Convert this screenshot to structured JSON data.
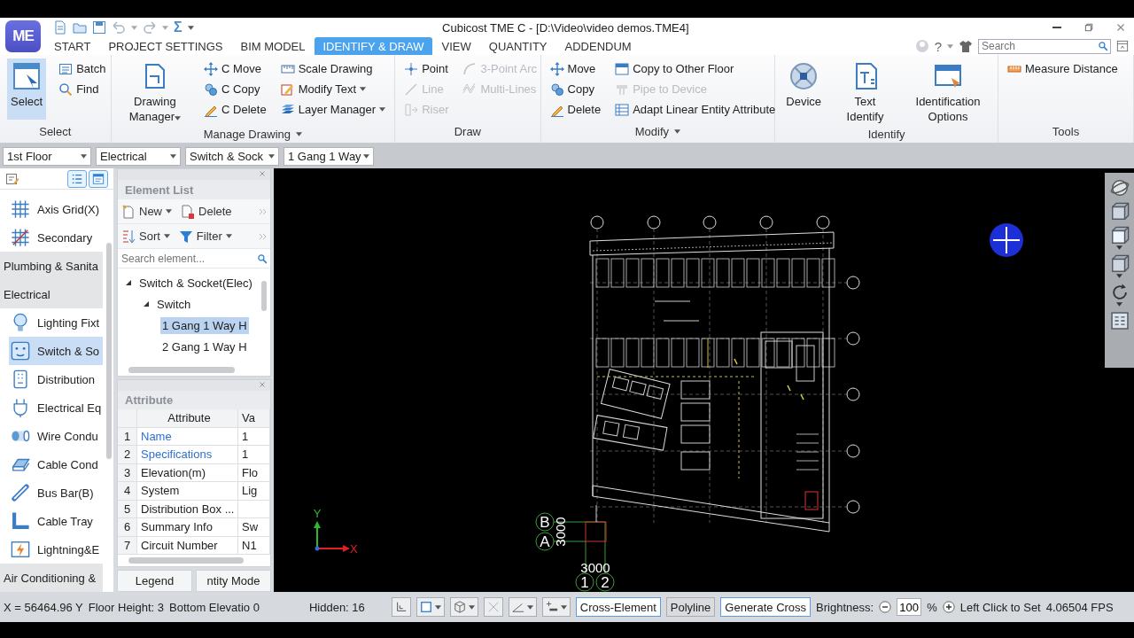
{
  "window": {
    "logo": "ME",
    "formula_symbol": "Σ",
    "title": "Cubicost TME C - [D:\\Video\\video demos.TME4]"
  },
  "menu_tabs": [
    {
      "label": "START",
      "selected": false
    },
    {
      "label": "PROJECT SETTINGS",
      "selected": false
    },
    {
      "label": "BIM MODEL",
      "selected": false
    },
    {
      "label": "IDENTIFY & DRAW",
      "selected": true
    },
    {
      "label": "VIEW",
      "selected": false
    },
    {
      "label": "QUANTITY",
      "selected": false
    },
    {
      "label": "ADDENDUM",
      "selected": false
    }
  ],
  "help": "?",
  "search": {
    "placeholder": "Search"
  },
  "ribbon": [
    {
      "label": "Select",
      "dropdown": false,
      "columns": [
        {
          "kind": "large",
          "label": "Select",
          "selected": true,
          "dropdown": false
        },
        {
          "kind": "stack",
          "items": [
            {
              "label": "Batch",
              "disabled": false,
              "dropdown": false
            },
            {
              "label": "Find",
              "disabled": false,
              "dropdown": false
            }
          ]
        }
      ]
    },
    {
      "label": "Manage Drawing",
      "dropdown": true,
      "columns": [
        {
          "kind": "large",
          "label": "Drawing Manager",
          "selected": false,
          "dropdown": true
        },
        {
          "kind": "stack",
          "items": [
            {
              "label": "C Move",
              "disabled": false,
              "dropdown": false
            },
            {
              "label": "C Copy",
              "disabled": false,
              "dropdown": false
            },
            {
              "label": "C Delete",
              "disabled": false,
              "dropdown": false
            }
          ]
        },
        {
          "kind": "stack",
          "items": [
            {
              "label": "Scale Drawing",
              "disabled": false,
              "dropdown": false
            },
            {
              "label": "Modify Text",
              "disabled": false,
              "dropdown": true
            },
            {
              "label": "Layer Manager",
              "disabled": false,
              "dropdown": true
            }
          ]
        }
      ]
    },
    {
      "label": "Draw",
      "dropdown": false,
      "columns": [
        {
          "kind": "stack",
          "items": [
            {
              "label": "Point",
              "disabled": false,
              "dropdown": false
            },
            {
              "label": "Line",
              "disabled": true,
              "dropdown": false
            },
            {
              "label": "Riser",
              "disabled": true,
              "dropdown": false
            }
          ]
        },
        {
          "kind": "stack",
          "items": [
            {
              "label": "3-Point Arc",
              "disabled": true,
              "dropdown": false
            },
            {
              "label": "Multi-Lines",
              "disabled": true,
              "dropdown": false
            }
          ]
        }
      ]
    },
    {
      "label": "Modify",
      "dropdown": true,
      "columns": [
        {
          "kind": "stack",
          "items": [
            {
              "label": "Move",
              "disabled": false,
              "dropdown": false
            },
            {
              "label": "Copy",
              "disabled": false,
              "dropdown": false
            },
            {
              "label": "Delete",
              "disabled": false,
              "dropdown": false
            }
          ]
        },
        {
          "kind": "stack",
          "items": [
            {
              "label": "Copy to Other Floor",
              "disabled": false,
              "dropdown": false
            },
            {
              "label": "Pipe to Device",
              "disabled": true,
              "dropdown": false
            },
            {
              "label": "Adapt Linear Entity Attribute",
              "disabled": false,
              "dropdown": false
            }
          ]
        }
      ]
    },
    {
      "label": "Identify",
      "dropdown": false,
      "columns": [
        {
          "kind": "large",
          "label": "Device",
          "selected": false,
          "dropdown": false
        },
        {
          "kind": "large",
          "label": "Text Identify",
          "selected": false,
          "dropdown": false
        },
        {
          "kind": "large",
          "label": "Identification Options",
          "selected": false,
          "dropdown": false
        }
      ]
    },
    {
      "label": "Tools",
      "dropdown": false,
      "columns": [
        {
          "kind": "stack",
          "items": [
            {
              "label": "Measure Distance",
              "disabled": false,
              "dropdown": false
            }
          ]
        }
      ]
    }
  ],
  "selectors": [
    "1st Floor",
    "Electrical",
    "Switch & Sock",
    "1 Gang 1 Way"
  ],
  "component_panel": [
    {
      "kind": "item",
      "label": "Axis Grid(X)",
      "selected": false
    },
    {
      "kind": "item",
      "label": "Secondary",
      "selected": false
    },
    {
      "kind": "category",
      "label": "Plumbing & Sanita",
      "selected": false
    },
    {
      "kind": "category",
      "label": "Electrical",
      "selected": false
    },
    {
      "kind": "item",
      "label": "Lighting Fixt",
      "selected": false
    },
    {
      "kind": "item",
      "label": "Switch & So",
      "selected": true
    },
    {
      "kind": "item",
      "label": "Distribution",
      "selected": false
    },
    {
      "kind": "item",
      "label": "Electrical Eq",
      "selected": false
    },
    {
      "kind": "item",
      "label": "Wire Condu",
      "selected": false
    },
    {
      "kind": "item",
      "label": "Cable Cond",
      "selected": false
    },
    {
      "kind": "item",
      "label": "Bus Bar(B)",
      "selected": false
    },
    {
      "kind": "item",
      "label": "Cable Tray",
      "selected": false
    },
    {
      "kind": "item",
      "label": "Lightning&E",
      "selected": false
    },
    {
      "kind": "category",
      "label": "Air Conditioning &",
      "selected": false
    }
  ],
  "element_list": {
    "title": "Element List",
    "actions": [
      [
        {
          "label": "New",
          "dropdown": true
        },
        {
          "label": "Delete",
          "dropdown": false
        }
      ],
      [
        {
          "label": "Sort",
          "dropdown": true
        },
        {
          "label": "Filter",
          "dropdown": true
        }
      ]
    ],
    "search_placeholder": "Search element...",
    "tree": [
      {
        "label": "Switch & Socket(Elec)",
        "expanded": true,
        "selected": false,
        "children": [
          {
            "label": "Switch",
            "expanded": true,
            "selected": false,
            "children": [
              {
                "label": "1 Gang 1 Way H",
                "selected": true
              },
              {
                "label": "2 Gang 1 Way H",
                "selected": false
              }
            ]
          }
        ]
      }
    ]
  },
  "attribute_panel": {
    "title": "Attribute",
    "columns": [
      "Attribute",
      "Va"
    ],
    "rows": [
      {
        "index": "1",
        "name": "Name",
        "value": "1",
        "kind": "linked"
      },
      {
        "index": "2",
        "name": "Specifications",
        "value": "1",
        "kind": "linked"
      },
      {
        "index": "3",
        "name": "Elevation(m)",
        "value": "Flo",
        "kind": "plain"
      },
      {
        "index": "4",
        "name": "System",
        "value": "Lig",
        "kind": "plain"
      },
      {
        "index": "5",
        "name": "Distribution Box ...",
        "kind": "plain"
      },
      {
        "index": "6",
        "name": "Summary Info",
        "value": "Sw",
        "kind": "plain"
      },
      {
        "index": "7",
        "name": "Circuit Number",
        "value": "N1",
        "kind": "plain"
      }
    ]
  },
  "bottom_tabs": [
    "Legend",
    "ntity Mode"
  ],
  "canvas": {
    "axis_labels": [
      "Y",
      "X"
    ],
    "row_labels": [
      "B",
      "A"
    ],
    "row_spacing": "3000",
    "column_labels": [
      "1",
      "2"
    ],
    "column_spacing": "3000"
  },
  "status_bar": {
    "coordinates": "X = 56464.96 Y",
    "floor_height": "Floor Height: 3",
    "bottom_elevation": "Bottom Elevatio 0",
    "hidden": "Hidden: 16",
    "toggles": [
      {
        "label": "Cross-Element",
        "on": true
      },
      {
        "label": "Polyline",
        "on": false
      },
      {
        "label": "Generate Cross",
        "on": true
      }
    ],
    "brightness_label": "Brightness:",
    "brightness_value": "100",
    "brightness_unit": "%",
    "hint": "Left Click to Set",
    "fps": "4.06504 FPS"
  }
}
